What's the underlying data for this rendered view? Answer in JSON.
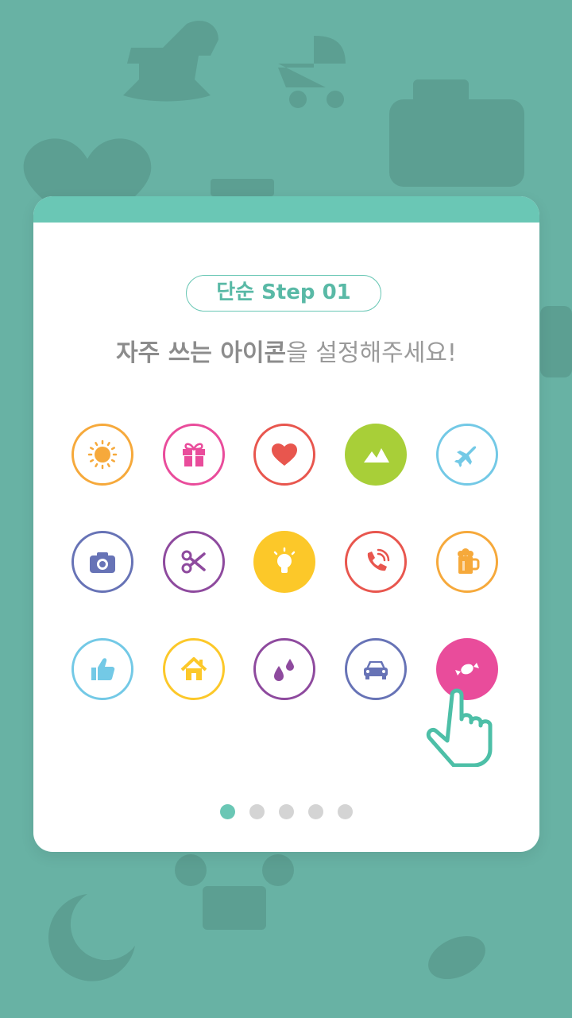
{
  "badge": {
    "label": "단순 Step 01"
  },
  "headline": {
    "bold": "자주 쓰는 아이콘",
    "rest": "을 설정해주세요!"
  },
  "icons": [
    {
      "name": "sun-icon",
      "color": "#f6a93b"
    },
    {
      "name": "gift-icon",
      "color": "#e94c9b"
    },
    {
      "name": "heart-icon",
      "color": "#e8564e"
    },
    {
      "name": "mountain-icon",
      "color": "#a8cf38"
    },
    {
      "name": "airplane-icon",
      "color": "#73c9e6"
    },
    {
      "name": "camera-icon",
      "color": "#6773b6"
    },
    {
      "name": "scissors-icon",
      "color": "#8e4a9e"
    },
    {
      "name": "lightbulb-icon",
      "color": "#fcc829"
    },
    {
      "name": "phone-icon",
      "color": "#e8564e"
    },
    {
      "name": "beer-icon",
      "color": "#f6a93b"
    },
    {
      "name": "thumbs-up-icon",
      "color": "#73c9e6"
    },
    {
      "name": "home-icon",
      "color": "#fcc829"
    },
    {
      "name": "water-drops-icon",
      "color": "#8e4a9e"
    },
    {
      "name": "car-icon",
      "color": "#6773b6"
    },
    {
      "name": "candy-icon",
      "color": "#e94c9b",
      "selected": true
    }
  ],
  "pagination": {
    "total": 5,
    "active": 1
  },
  "colors": {
    "background": "#68b2a4",
    "accent": "#6ac7b5"
  }
}
